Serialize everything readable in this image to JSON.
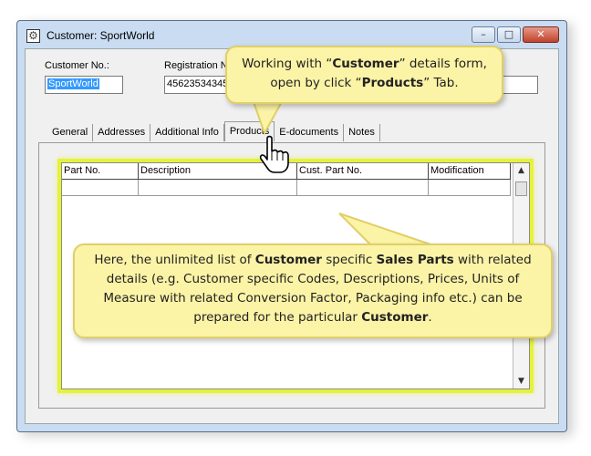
{
  "window": {
    "title": "Customer: SportWorld",
    "minimize": "–",
    "maximize": "□",
    "close": "✕"
  },
  "form": {
    "customer_no_label": "Customer No.:",
    "customer_no_value": "SportWorld",
    "registration_label": "Registration N",
    "registration_value": "456235343456"
  },
  "tabs": [
    "General",
    "Addresses",
    "Additional Info",
    "Products",
    "E-documents",
    "Notes"
  ],
  "active_tab": "Products",
  "grid": {
    "columns": [
      "Part No.",
      "Description",
      "Cust. Part No.",
      "Modification"
    ]
  },
  "callouts": {
    "top": {
      "t1": "Working with “",
      "b1": "Customer",
      "t2": "” details form, open by click “",
      "b2": "Products",
      "t3": "” Tab."
    },
    "bottom": {
      "t1": "Here, the unlimited list of ",
      "b1": "Customer",
      "t2": " specific ",
      "b2": "Sales Parts",
      "t3": " with related details (e.g. Customer specific Codes, Descriptions, Prices, Units of Measure with related Conversion Factor, Packaging info etc.) can be prepared for the particular ",
      "b3": "Customer",
      "t4": "."
    }
  },
  "colors": {
    "highlight": "#e6f23a",
    "callout_bg": "#fbf3a6",
    "selection": "#3399ff"
  }
}
